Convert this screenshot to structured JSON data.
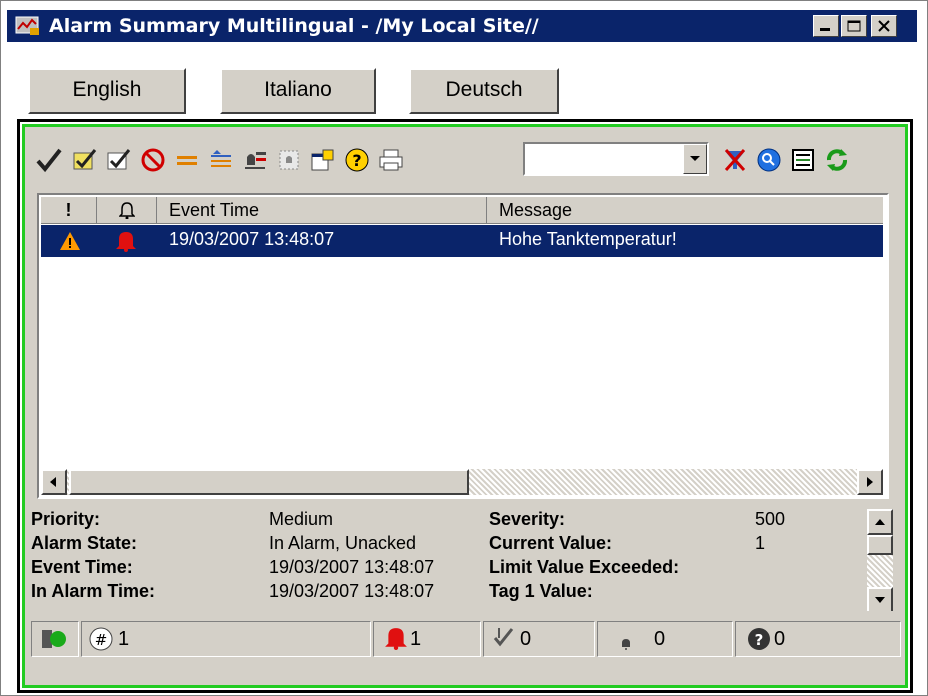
{
  "window": {
    "title": "Alarm Summary Multilingual - /My Local Site//",
    "app_icon": "alarm-app-icon",
    "controls": [
      "minimize",
      "maximize",
      "close"
    ]
  },
  "language_buttons": [
    "English",
    "Italiano",
    "Deutsch"
  ],
  "toolbar": {
    "icons": [
      "acknowledge-icon",
      "acknowledge-all-icon",
      "acknowledge-page-icon",
      "disable-icon",
      "filter-equal-icon",
      "sort-icon",
      "alarm-groups-icon",
      "alarm-display-icon",
      "properties-icon",
      "help-icon",
      "print-icon",
      "filter-clear-icon",
      "zoom-icon",
      "list-view-icon",
      "refresh-icon"
    ],
    "combo_value": ""
  },
  "list": {
    "columns": [
      "!",
      "△",
      "Event Time",
      "Message"
    ],
    "rows": [
      {
        "priority_icon": "warning-icon",
        "state_icon": "bell-icon",
        "event_time": "19/03/2007 13:48:07",
        "message": "Hohe Tanktemperatur!",
        "selected": true
      }
    ]
  },
  "details": {
    "left": [
      {
        "label": "Priority:",
        "value": "Medium"
      },
      {
        "label": "Alarm State:",
        "value": "In Alarm, Unacked"
      },
      {
        "label": "Event Time:",
        "value": "19/03/2007 13:48:07"
      },
      {
        "label": "In Alarm Time:",
        "value": "19/03/2007 13:48:07"
      }
    ],
    "right": [
      {
        "label": "Severity:",
        "value": "500"
      },
      {
        "label": "Current Value:",
        "value": "1"
      },
      {
        "label": "Limit Value Exceeded:",
        "value": ""
      },
      {
        "label": "Tag 1 Value:",
        "value": ""
      }
    ]
  },
  "status": {
    "total_count": "1",
    "in_alarm_count": "1",
    "acked_count": "0",
    "bell_count": "0",
    "unknown_count": "0"
  },
  "colors": {
    "title_bar": "#0a246a",
    "selection": "#0a246a",
    "frame_border": "#22cc22",
    "face": "#d4d0c8"
  }
}
